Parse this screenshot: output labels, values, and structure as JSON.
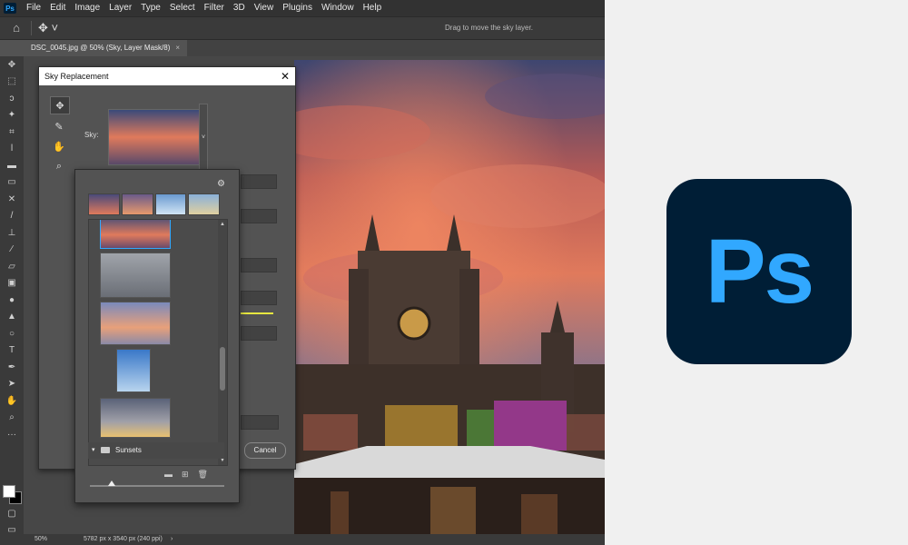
{
  "app": {
    "logo_text": "Ps"
  },
  "menu": [
    "File",
    "Edit",
    "Image",
    "Layer",
    "Type",
    "Select",
    "Filter",
    "3D",
    "View",
    "Plugins",
    "Window",
    "Help"
  ],
  "options_bar": {
    "hint": "Drag to move the sky layer."
  },
  "document_tab": {
    "label": "DSC_0045.jpg @ 50% (Sky, Layer Mask/8)",
    "close": "×"
  },
  "tools": [
    "move-tool",
    "marquee-tool",
    "lasso-tool",
    "magic-wand-tool",
    "crop-tool",
    "eyedropper-tool",
    "healing-brush-tool",
    "brush-tool",
    "clone-stamp-tool",
    "history-brush-tool",
    "eraser-tool",
    "gradient-tool",
    "blur-tool",
    "dodge-tool",
    "pen-tool",
    "type-tool",
    "path-selection-tool",
    "shape-tool",
    "hand-tool",
    "zoom-tool"
  ],
  "dialog": {
    "title": "Sky Replacement",
    "close": "✕",
    "sky_label": "Sky:",
    "cancel": "Cancel"
  },
  "sky_picker": {
    "group_name": "Sunsets"
  },
  "status": {
    "zoom": "50%",
    "doc_info": "5782 px x 3540 px (240 ppi)",
    "arrow": "›"
  },
  "brand": {
    "logo_text": "Ps",
    "bg": "#001e36",
    "fg": "#31a8ff"
  }
}
